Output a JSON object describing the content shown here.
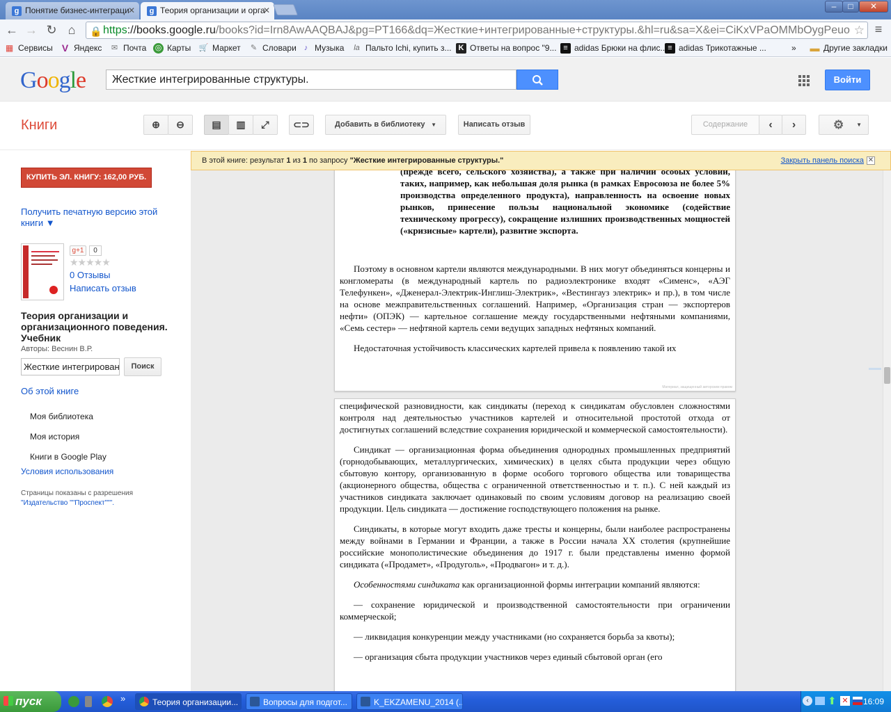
{
  "browser": {
    "tabs": [
      {
        "title": "Понятие бизнес-интеграци",
        "favicon": "g"
      },
      {
        "title": "Теория организации и орга",
        "favicon": "g"
      }
    ],
    "address": {
      "scheme": "https",
      "host": "://books.google.ru",
      "path": "/books?id=Irn8AwAAQBAJ&pg=PT166&dq=Жесткие+интегрированные+структуры.&hl=ru&sa=X&ei=CiKxVPaOMMbOygPeuo"
    },
    "bookmarks": [
      {
        "label": "Сервисы",
        "icon": "apps-icon",
        "color": "#e0433a"
      },
      {
        "label": "Яндекс",
        "icon": "yandex-icon",
        "color": "#9b2a8f"
      },
      {
        "label": "Почта",
        "icon": "mail-icon",
        "color": "#888"
      },
      {
        "label": "Карты",
        "icon": "maps-icon",
        "color": "#3a9a3a"
      },
      {
        "label": "Маркет",
        "icon": "market-icon",
        "color": "#777"
      },
      {
        "label": "Словари",
        "icon": "dictionary-icon",
        "color": "#777"
      },
      {
        "label": "Музыка",
        "icon": "music-icon",
        "color": "#6a5acd"
      },
      {
        "label": "Пальто Ichi, купить з...",
        "icon": "la-icon",
        "color": "#777"
      },
      {
        "label": "Ответы на вопрос \"9...",
        "icon": "k-icon",
        "color": "#222"
      },
      {
        "label": "adidas Брюки на флис...",
        "icon": "adidas-icon",
        "color": "#111"
      },
      {
        "label": "adidas Трикотажные ...",
        "icon": "adidas-icon",
        "color": "#111"
      }
    ],
    "bookmarks_more": "»",
    "other_bookmarks": "Другие закладки"
  },
  "google": {
    "search_value": "Жесткие интегрированные структуры.",
    "login": "Войти"
  },
  "books_toolbar": {
    "title": "Книги",
    "add_to_library": "Добавить в библиотеку",
    "write_review": "Написать отзыв",
    "contents": "Содержание"
  },
  "result_bar": {
    "prefix": "В этой книге: результат ",
    "current": "1",
    "of": " из ",
    "total": "1",
    "query_prefix": " по запросу ",
    "query": "\"Жесткие интегрированные структуры.\"",
    "close": "Закрыть панель поиска"
  },
  "sidebar": {
    "buy": "КУПИТЬ ЭЛ. КНИГУ: 162,00 РУБ.",
    "print_version": "Получить печатную версию этой книги ▼",
    "gplus": "g+1",
    "gplus_count": "0",
    "stars": "★★★★★",
    "reviews": "0 Отзывы",
    "write_review": "Написать отзыв",
    "book_title": "Теория организации и организационного поведения. Учебник",
    "authors": "Авторы: Веснин В.Р.",
    "in_book_search": "Жесткие интегрированн",
    "search_btn": "Поиск",
    "about": "Об этой книге",
    "my_library": "Моя библиотека",
    "my_history": "Моя история",
    "google_play": "Книги в Google Play",
    "terms": "Условия использования",
    "permission": "Страницы показаны с разрешения",
    "publisher": "\"Издательство \"\"Проспект\"\"\"."
  },
  "page1": {
    "bold_lines": "(прежде всего, сельского хозяйства), а также при наличии особых условий, таких, например, как небольшая доля рынка (в рамках Евросоюза не более 5% производства определенного продукта), направленность на освоение новых рынков, принесение пользы национальной экономике (содействие техническому прогрессу), сокращение излишних производственных мощностей («кризисные» картели), развитие экспорта.",
    "para1": "Поэтому в основном картели являются международными. В них могут объединяться концерны и конгломераты (в международный картель по радиоэлектронике входят «Сименс», «АЭГ Телефункен», «Дженерал-Электрик-Инглиш-Электрик», «Вестингауз электрик» и пр.), в том числе на основе межправительственных соглашений. Например, «Организация стран — экспортеров нефти» (ОПЭК) — картельное соглашение между государственными нефтяными компаниями, «Семь сестер» — нефтяной картель семи ведущих западных нефтяных компаний.",
    "para2": "Недостаточная устойчивость классических картелей привела к появлению такой их",
    "watermark": "Материал, защищенный авторским правом"
  },
  "page2": {
    "para1": "специфической разновидности, как синдикаты (переход к синдикатам обусловлен сложностями контроля над деятельностью участников картелей и относительной простотой отхода от достигнутых соглашений вследствие сохранения юридической и коммерческой самостоятельности).",
    "para2": "Синдикат — организационная форма объединения однородных промышленных предприятий (горнодобывающих, металлургических, химических) в целях сбыта продукции через общую сбытовую контору, организованную в форме особого торгового общества или товарищества (акционерного общества, общества с ограниченной ответственностью и т. п.). С ней каждый из участников синдиката заключает одинаковый по своим условиям договор на реализацию своей продукции. Цель синдиката — достижение господствующего положения на рынке.",
    "para3": "Синдикаты, в которые могут входить даже тресты и концерны, были наиболее распространены между войнами в Германии и Франции, а также в России начала XX столетия (крупнейшие российские монополистические объединения до 1917 г. были представлены именно формой синдиката («Продамет», «Продуголь», «Продвагон» и т. д.).",
    "para4_em": "Особенностями синдиката",
    "para4_rest": " как организационной формы интеграции компаний являются:",
    "item1": "— сохранение юридической и производственной самостоятельности при ограничении коммерческой;",
    "item2": "— ликвидация конкуренции между участниками (но сохраняется борьба за квоты);",
    "item3": "— организация сбыта продукции участников через единый сбытовой орган (его"
  },
  "taskbar": {
    "start": "пуск",
    "items": [
      {
        "label": "Теория организации...",
        "icon": "chrome-icon",
        "color": "#e8453c"
      },
      {
        "label": "Вопросы для подгот...",
        "icon": "word-icon",
        "color": "#2b5797"
      },
      {
        "label": "K_EKZAMENU_2014 (...",
        "icon": "word-icon",
        "color": "#2b5797"
      }
    ],
    "clock": "16:09"
  }
}
